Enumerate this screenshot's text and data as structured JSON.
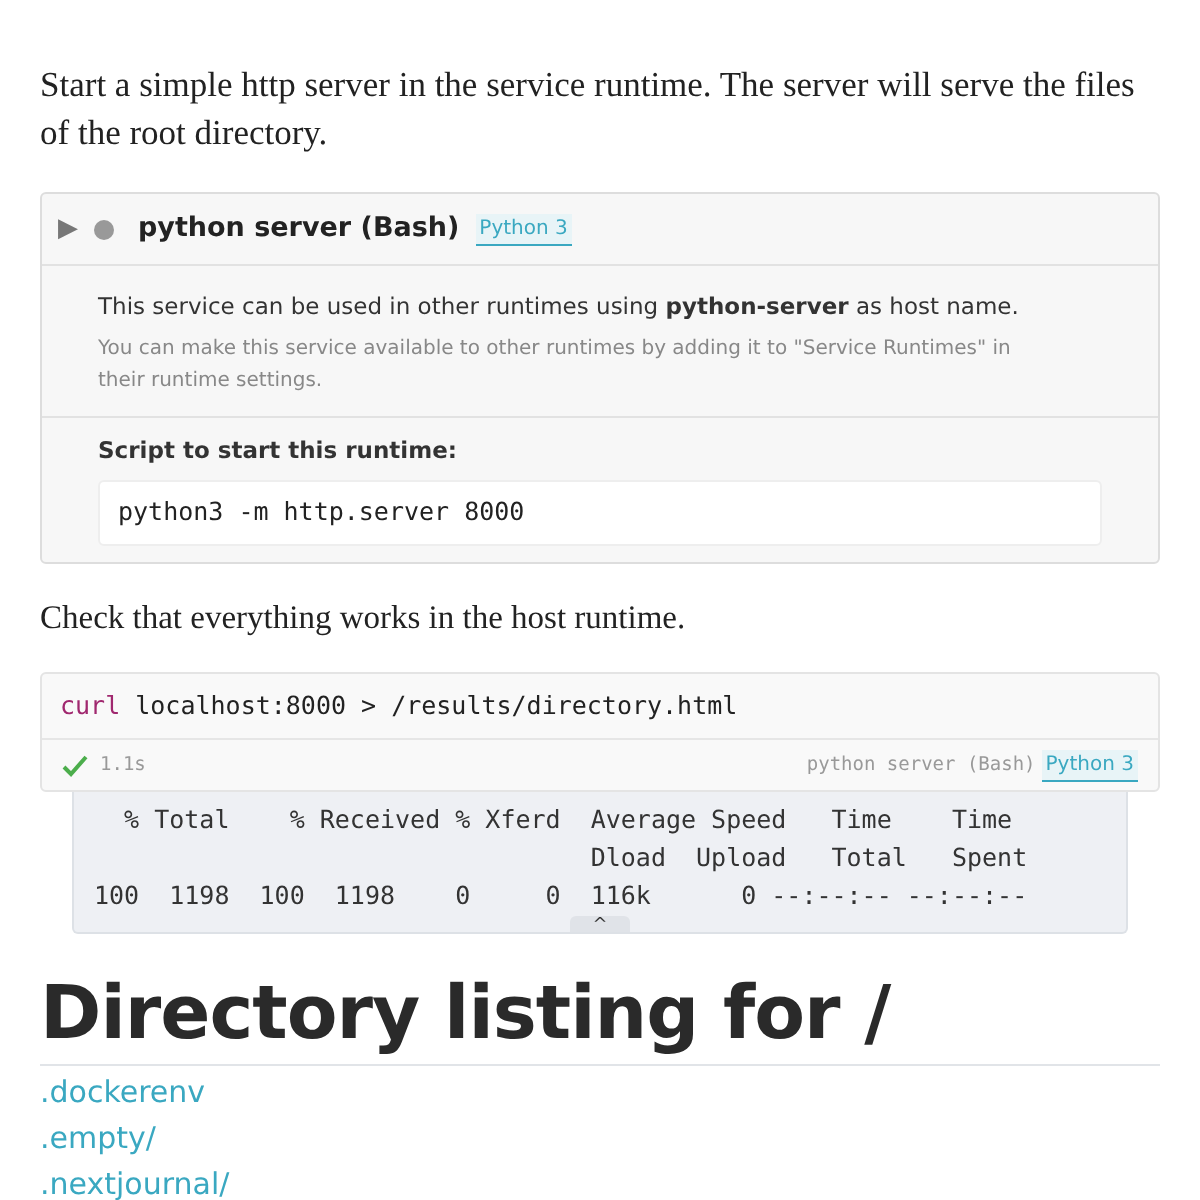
{
  "intro": "Start a simple http server in the service runtime. The server will serve the files of the root directory.",
  "service": {
    "toggle": "▶",
    "title": "python server (Bash)",
    "tag": "Python 3",
    "note": "This service can be used in other runtimes using **python-server** as host name.",
    "hint": "You can make this service available to other runtimes by adding it to \"Service Runtimes\" in their runtime settings.",
    "script_label": "Script to start this runtime:",
    "script": "python3 -m http.server 8000"
  },
  "check_text": "Check that everything works in the host runtime.",
  "cell": {
    "command": "curl",
    "args": " localhost:8000 > /results/directory.html",
    "duration": "1.1s",
    "runtime": "python server (Bash)",
    "tag": "Python 3",
    "output": [
      "  % Total    % Received % Xferd  Average Speed   Time    Time",
      "                                 Dload  Upload   Total   Spent",
      "100  1198  100  1198    0     0  116k      0 --:--:-- --:--:--"
    ],
    "collapse": "^"
  },
  "heading": "Directory listing for /",
  "links": [
    ".dockerenv",
    ".empty/",
    ".nextjournal/"
  ]
}
